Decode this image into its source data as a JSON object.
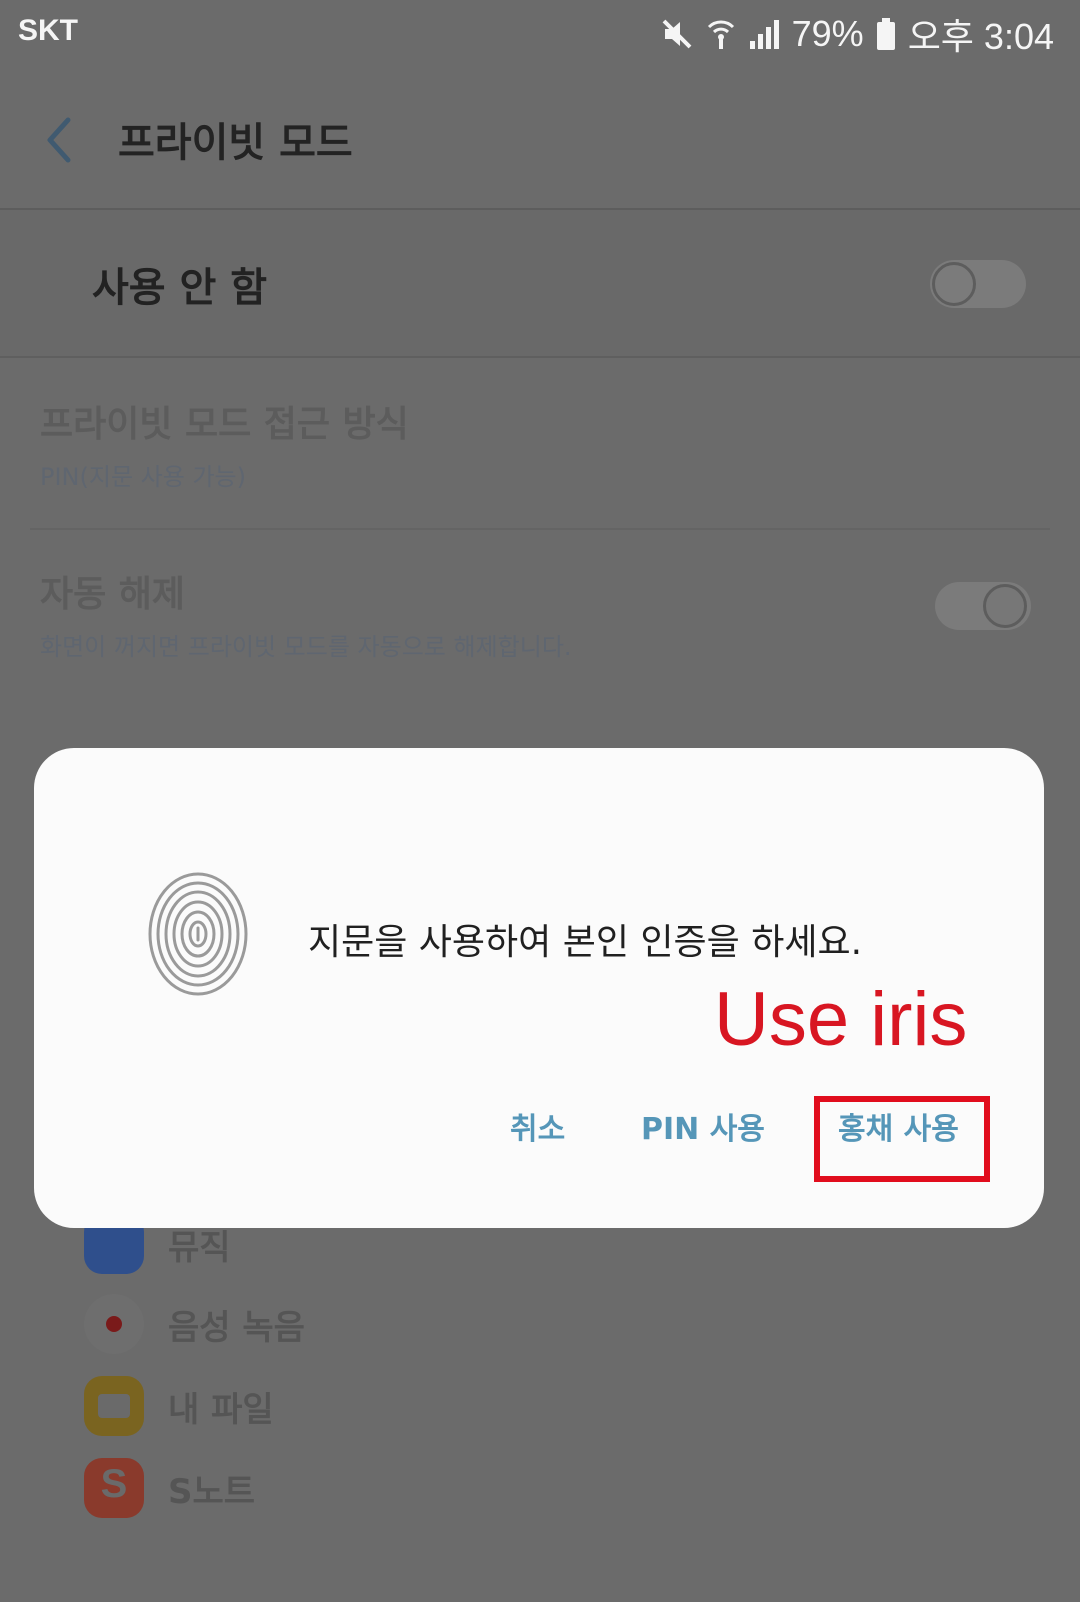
{
  "status_bar": {
    "carrier": "SKT",
    "battery": "79%",
    "time": "오후 3:04"
  },
  "header": {
    "title": "프라이빗 모드"
  },
  "main_toggle": {
    "label": "사용 안 함",
    "state": "off"
  },
  "settings": [
    {
      "title": "프라이빗 모드 접근 방식",
      "subtitle": "PIN(지문 사용 가능)"
    },
    {
      "title": "자동 해제",
      "subtitle": "화면이 꺼지면 프라이빗 모드를 자동으로 해제합니다."
    }
  ],
  "apps": [
    {
      "label": "뮤직",
      "icon": "music-icon",
      "color": "#2f4f8c"
    },
    {
      "label": "음성 녹음",
      "icon": "voice-recorder-icon",
      "color": "#6a6a6a"
    },
    {
      "label": "내 파일",
      "icon": "my-files-icon",
      "color": "#7a6420"
    },
    {
      "label": "S노트",
      "icon": "s-note-icon",
      "color": "#8a3a2c"
    }
  ],
  "dialog": {
    "message": "지문을 사용하여 본인 인증을 하세요.",
    "buttons": {
      "cancel": "취소",
      "use_pin": "PIN 사용",
      "use_iris": "홍채 사용"
    }
  },
  "annotation": {
    "text": "Use iris",
    "color": "#e10d1d"
  },
  "colors": {
    "dialog_button": "#5596b8",
    "overlay": "#6b6b6b"
  }
}
